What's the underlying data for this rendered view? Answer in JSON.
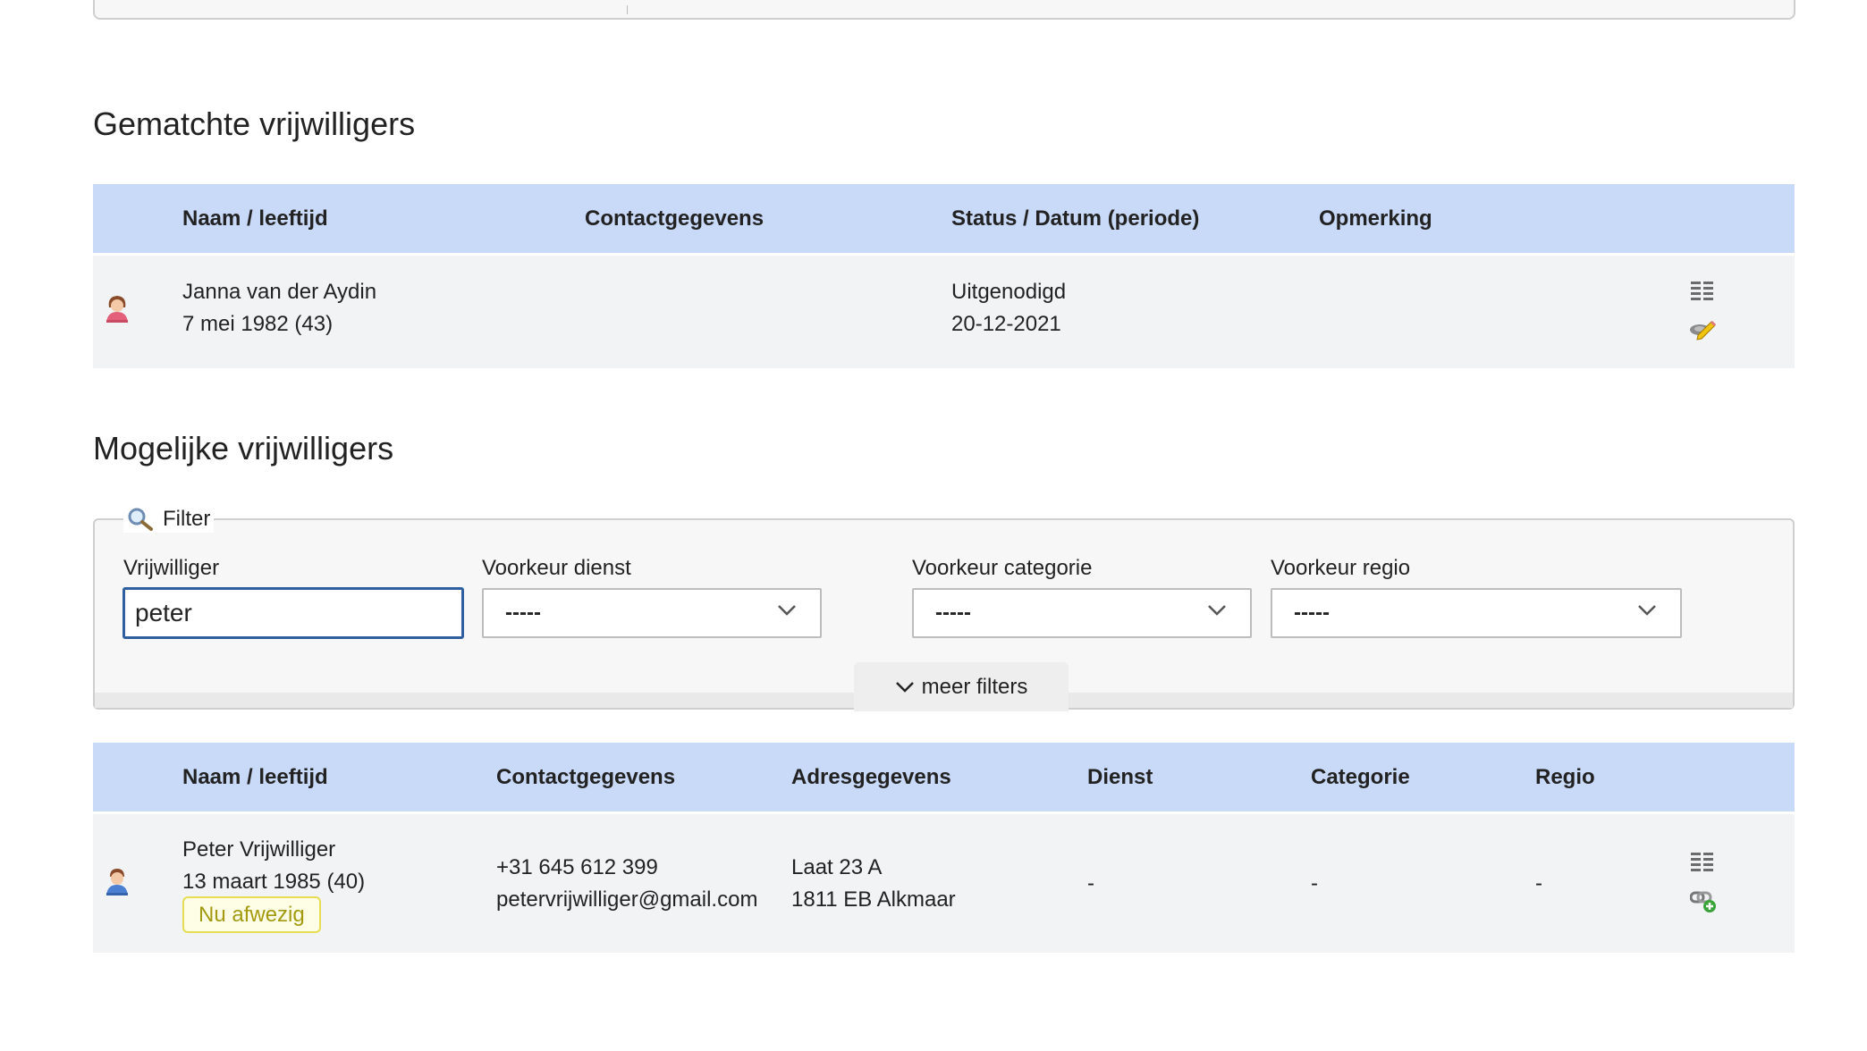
{
  "matched": {
    "title": "Gematchte vrijwilligers",
    "headers": {
      "name": "Naam / leeftijd",
      "contact": "Contactgegevens",
      "status": "Status / Datum (periode)",
      "remark": "Opmerking"
    },
    "rows": [
      {
        "name": "Janna van der Aydin",
        "birth": "7 mei 1982 (43)",
        "status": "Uitgenodigd",
        "date": "20-12-2021",
        "avatar_icon": "female-user-icon",
        "actions": [
          "details-list-icon",
          "edit-pencil-icon"
        ]
      }
    ]
  },
  "possible": {
    "title": "Mogelijke vrijwilligers",
    "filter": {
      "legend": "Filter",
      "legend_icon": "magnifier-icon",
      "volunteer_label": "Vrijwilliger",
      "volunteer_value": "peter",
      "service_label": "Voorkeur dienst",
      "service_value": "-----",
      "category_label": "Voorkeur categorie",
      "category_value": "-----",
      "region_label": "Voorkeur regio",
      "region_value": "-----",
      "more_filters": "meer filters"
    },
    "headers": {
      "name": "Naam / leeftijd",
      "contact": "Contactgegevens",
      "address": "Adresgegevens",
      "service": "Dienst",
      "category": "Categorie",
      "region": "Regio"
    },
    "rows": [
      {
        "name": "Peter Vrijwilliger",
        "birth": "13 maart 1985 (40)",
        "badge": "Nu afwezig",
        "phone": "+31 645 612 399",
        "email": "petervrijwilliger@gmail.com",
        "street": "Laat 23 A",
        "city": "1811 EB Alkmaar",
        "service": "-",
        "category": "-",
        "region": "-",
        "avatar_icon": "male-user-icon",
        "actions": [
          "details-list-icon",
          "add-link-icon"
        ]
      }
    ]
  },
  "colors": {
    "table_header": "#c9d9f8",
    "row_bg": "#f2f3f5",
    "input_focus_border": "#2f5f9e",
    "badge_border": "#e6dd55",
    "badge_text": "#a39a10"
  }
}
